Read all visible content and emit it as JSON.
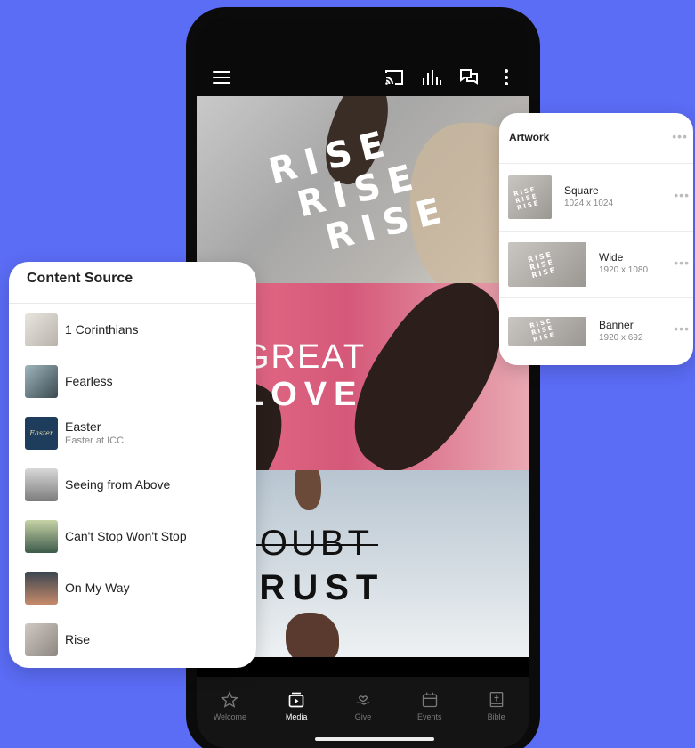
{
  "phone": {
    "tiles": {
      "rise_lines": [
        "RISE",
        "RISE",
        "RISE"
      ],
      "great": "GREAT",
      "love": "LOVE",
      "doubt": "DOUBT",
      "trust": "TRUST"
    },
    "tabs": [
      {
        "label": "Welcome",
        "icon": "star-icon",
        "active": false
      },
      {
        "label": "Media",
        "icon": "media-icon",
        "active": true
      },
      {
        "label": "Give",
        "icon": "give-icon",
        "active": false
      },
      {
        "label": "Events",
        "icon": "calendar-icon",
        "active": false
      },
      {
        "label": "Bible",
        "icon": "bible-icon",
        "active": false
      }
    ],
    "toolbar_icons": [
      "cast-icon",
      "audio-bars-icon",
      "chat-icon",
      "more-vertical-icon"
    ]
  },
  "content_source": {
    "title": "Content Source",
    "items": [
      {
        "name": "1 Corinthians",
        "subtitle": ""
      },
      {
        "name": "Fearless",
        "subtitle": ""
      },
      {
        "name": "Easter",
        "subtitle": "Easter at ICC",
        "thumb_text": "Easter"
      },
      {
        "name": "Seeing from Above",
        "subtitle": ""
      },
      {
        "name": "Can't Stop Won't Stop",
        "subtitle": ""
      },
      {
        "name": "On My Way",
        "subtitle": ""
      },
      {
        "name": "Rise",
        "subtitle": ""
      }
    ]
  },
  "artwork": {
    "title": "Artwork",
    "more": "•••",
    "rows": [
      {
        "name": "Square",
        "size": "1024 x 1024"
      },
      {
        "name": "Wide",
        "size": "1920 x 1080"
      },
      {
        "name": "Banner",
        "size": "1920 x 692"
      }
    ]
  },
  "colors": {
    "background": "#5b6cf5",
    "love_tile": "#d55879"
  }
}
